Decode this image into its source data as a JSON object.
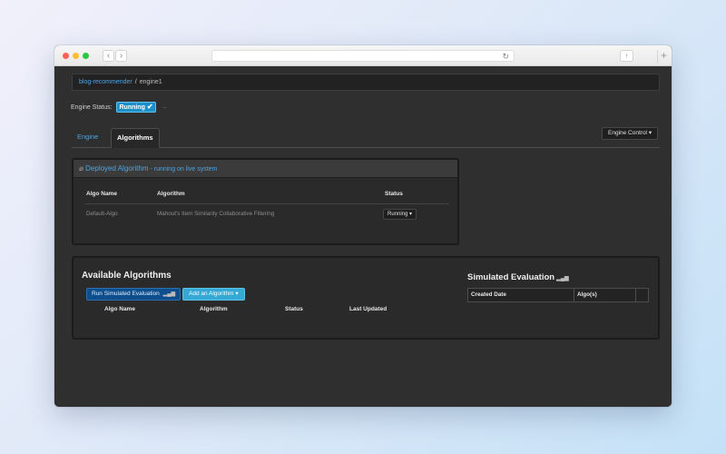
{
  "browser": {
    "back_glyph": "‹",
    "forward_glyph": "›",
    "reload_glyph": "↻",
    "icons": [
      "share-icon",
      "tabs-icon",
      "new-tab-icon"
    ]
  },
  "breadcrumb": {
    "app": "blog-recommender",
    "separator": "/",
    "engine": "engine1"
  },
  "engine_status": {
    "label": "Engine Status:",
    "value": "Running",
    "extra": "--"
  },
  "tabs": [
    {
      "label": "Engine",
      "active": false
    },
    {
      "label": "Algorithms",
      "active": true
    }
  ],
  "engine_control_label": "Engine Control",
  "deployed": {
    "title": "Deployed Algorithm",
    "subtitle": " - running on live system",
    "columns": [
      "Algo Name",
      "Algorithm",
      "Status"
    ],
    "rows": [
      {
        "name": "Default-Algo",
        "algorithm": "Mahout's Item Similarity Collaborative Filtering",
        "status": "Running"
      }
    ]
  },
  "available": {
    "title": "Available Algorithms",
    "run_sim_label": "Run Simulated Evaluation",
    "add_label": "Add an Algorithm",
    "columns": [
      "Algo Name",
      "Algorithm",
      "Status",
      "Last Updated"
    ]
  },
  "simulated": {
    "title": "Simulated Evaluation",
    "columns": [
      "Created Date",
      "Algo(s)",
      ""
    ]
  },
  "colors": {
    "accent": "#4aa5e6",
    "running_badge": "#1e90c9",
    "background": "#2f2f2f"
  }
}
